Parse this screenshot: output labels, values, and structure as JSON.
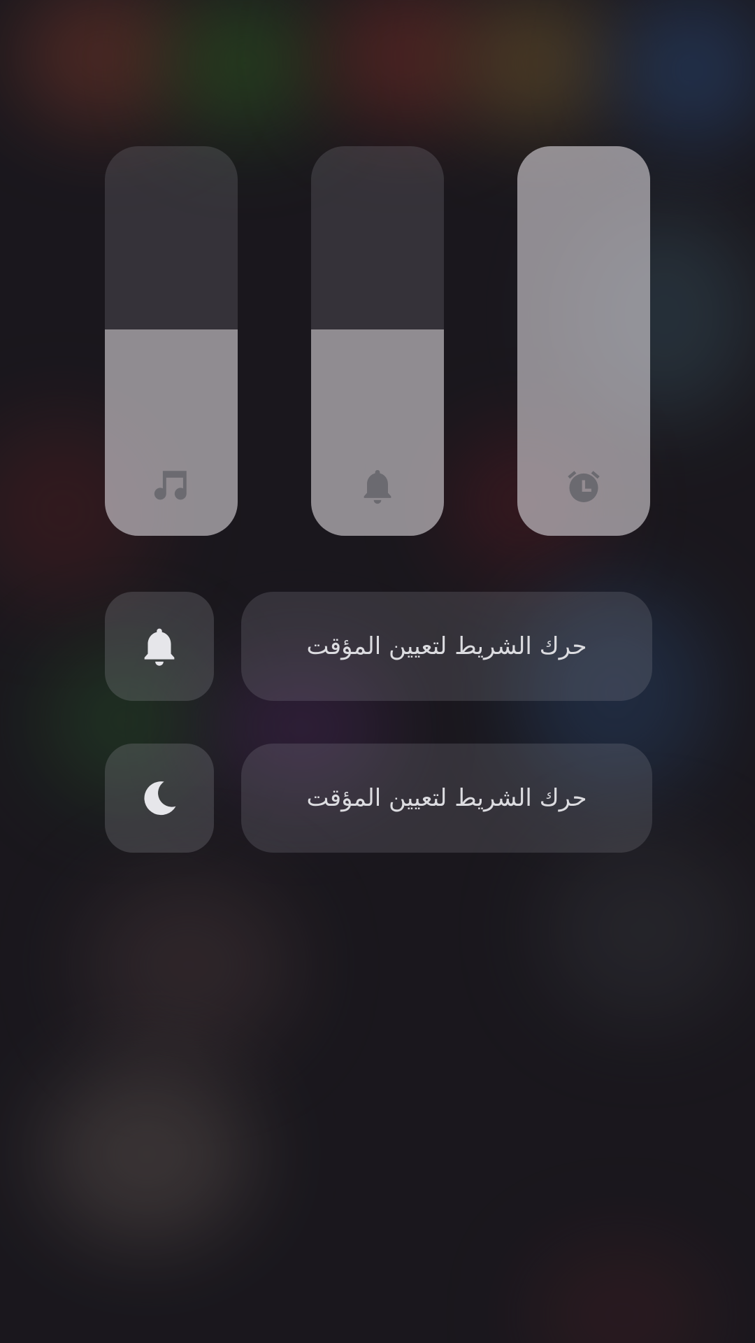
{
  "sliders": [
    {
      "id": "media",
      "icon": "music-note-icon",
      "level": 0.53
    },
    {
      "id": "ring",
      "icon": "bell-icon",
      "level": 0.53
    },
    {
      "id": "alarm",
      "icon": "alarm-clock-icon",
      "level": 1.0
    }
  ],
  "toggles": [
    {
      "icon": "bell-icon",
      "timer_label": "حرك الشريط لتعيين المؤقت"
    },
    {
      "icon": "moon-icon",
      "timer_label": "حرك الشريط لتعيين المؤقت"
    }
  ],
  "colors": {
    "slider_fill": "#c8c4c8",
    "text": "#dcdce0",
    "icon_on_fill": "#6b6a70",
    "icon_on_panel": "#e6e6ea"
  }
}
